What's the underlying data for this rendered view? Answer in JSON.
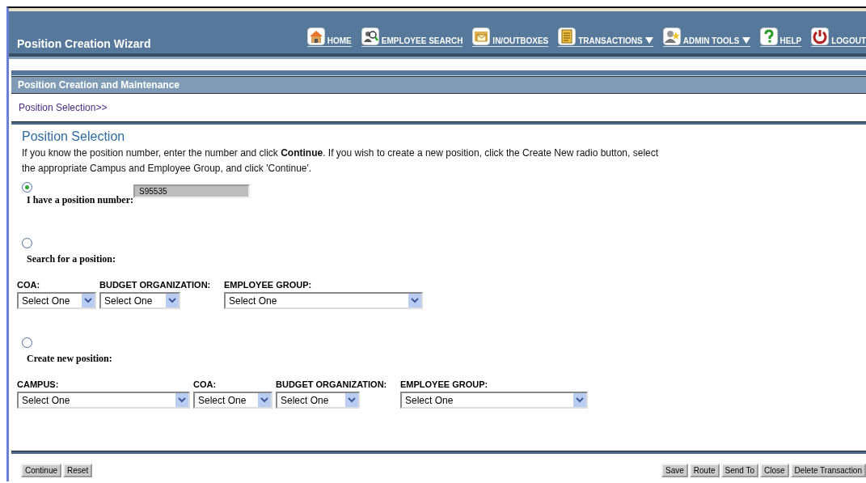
{
  "header": {
    "title": "Position Creation Wizard",
    "nav": [
      {
        "label": "HOME",
        "dropdown": false
      },
      {
        "label": "EMPLOYEE SEARCH",
        "dropdown": false
      },
      {
        "label": "IN/OUTBOXES",
        "dropdown": false
      },
      {
        "label": "TRANSACTIONS",
        "dropdown": true
      },
      {
        "label": "ADMIN TOOLS",
        "dropdown": true
      },
      {
        "label": "HELP",
        "dropdown": false
      },
      {
        "label": "LOGOUT",
        "dropdown": false
      }
    ]
  },
  "section_title": "Position Creation and Maintenance",
  "breadcrumb": "Position Selection>>",
  "page": {
    "title": "Position Selection",
    "intro": "If you know the position number, enter the number and click **Continue**. If you wish to create a new position, click the Create New radio button, select the appropriate Campus and Employee Group, and click 'Continue'.",
    "options": [
      {
        "label": "I have a position number:",
        "selected": true,
        "value": "S95535"
      },
      {
        "label": "Search for a position:",
        "selected": false,
        "selects": [
          {
            "label": "COA:",
            "value": "Select One"
          },
          {
            "label": "BUDGET ORGANIZATION:",
            "value": "Select One"
          },
          {
            "label": "EMPLOYEE GROUP:",
            "value": "Select One"
          }
        ]
      },
      {
        "label": "Create new position:",
        "selected": false,
        "selects": [
          {
            "label": "CAMPUS:",
            "value": "Select One"
          },
          {
            "label": "COA:",
            "value": "Select One"
          },
          {
            "label": "BUDGET ORGANIZATION:",
            "value": "Select One"
          },
          {
            "label": "EMPLOYEE GROUP:",
            "value": "Select One"
          }
        ]
      }
    ]
  },
  "left_buttons": [
    "Continue",
    "Reset"
  ],
  "right_buttons": [
    "Save",
    "Route",
    "Send To",
    "Close",
    "Delete Transaction"
  ]
}
